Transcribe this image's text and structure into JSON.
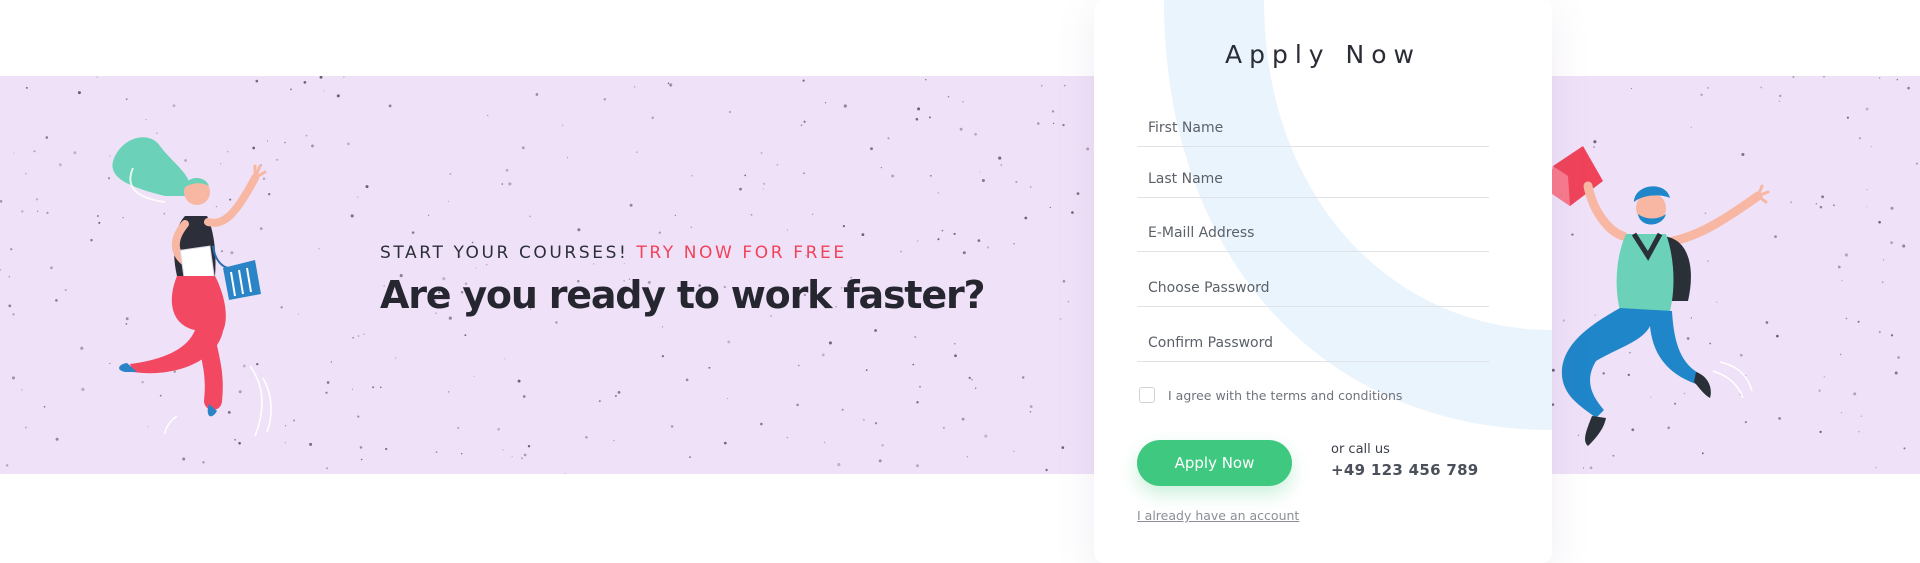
{
  "promo": {
    "tagline_lead": "START YOUR COURSES!",
    "tagline_accent": "TRY NOW FOR FREE",
    "headline": "Are you ready to work faster?"
  },
  "form": {
    "title": "Apply Now",
    "fields": {
      "first_name": {
        "placeholder": "First Name",
        "value": ""
      },
      "last_name": {
        "placeholder": "Last Name",
        "value": ""
      },
      "email": {
        "placeholder": "E-Maill Address",
        "value": ""
      },
      "password": {
        "placeholder": "Choose Password",
        "value": ""
      },
      "confirm_password": {
        "placeholder": "Confirm Password",
        "value": ""
      }
    },
    "terms_label": "I agree with the terms and conditions",
    "terms_checked": false,
    "submit_label": "Apply Now",
    "call_label": "or call us",
    "phone": "+49 123 456 789",
    "login_link": "I already have an account"
  },
  "colors": {
    "banner": "#efe2f8",
    "accent_red": "#f0435a",
    "button_green": "#3fc87f",
    "headline": "#25262f",
    "card_arc": "#eaf4fc"
  },
  "illustrations": [
    "woman-jumping-illustration",
    "man-jumping-illustration"
  ]
}
